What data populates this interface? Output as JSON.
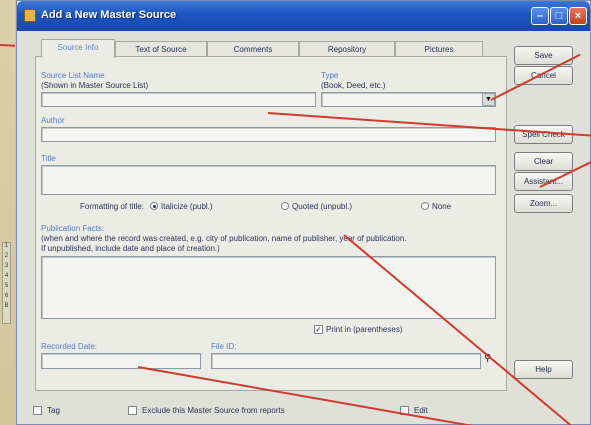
{
  "window": {
    "title": "Add a New Master Source"
  },
  "tabs": [
    {
      "label": "Source Info",
      "active": true
    },
    {
      "label": "Text of Source",
      "active": false
    },
    {
      "label": "Comments",
      "active": false
    },
    {
      "label": "Repository",
      "active": false
    },
    {
      "label": "Pictures",
      "active": false
    }
  ],
  "form": {
    "source_list_name_label": "Source List Name",
    "source_list_name_hint": "(Shown in Master Source List)",
    "source_list_name_value": "",
    "type_label": "Type",
    "type_hint": "(Book, Deed, etc.)",
    "type_value": "",
    "author_label": "Author",
    "author_value": "",
    "title_label": "Title",
    "title_value": "",
    "title_format_label": "Formatting of title:",
    "title_format_options": [
      "Italicize (publ.)",
      "Quoted (unpubl.)",
      "None"
    ],
    "title_format_selected": "Italicize (publ.)",
    "pub_facts_label": "Publication Facts:",
    "pub_facts_hint1": "(when and where the record was created, e.g. city of publication, name of publisher, year of publication.",
    "pub_facts_hint2": "If unpublished, include date and place of creation.)",
    "pub_facts_value": "",
    "print_in_parens_label": "Print in (parentheses)",
    "print_in_parens_checked": true,
    "recorded_date_label": "Recorded Date:",
    "recorded_date_value": "",
    "file_id_label": "File ID:",
    "file_id_value": ""
  },
  "side_buttons": {
    "save": "Save",
    "cancel": "Cancel",
    "spell_check": "Spell Check",
    "clear": "Clear",
    "assistant": "Assistant...",
    "zoom": "Zoom...",
    "help": "Help"
  },
  "bottom": {
    "tag_label": "Tag",
    "exclude_label": "Exclude this Master Source from reports",
    "edit_label": "Edit"
  },
  "side_strip_chars": [
    "1",
    "2",
    "3",
    "4",
    "5",
    "6",
    "B"
  ],
  "colors": {
    "titlebar": "#1c55c2",
    "annotation_arrow": "#d33a2e",
    "label_blue": "#4f7cc1"
  }
}
